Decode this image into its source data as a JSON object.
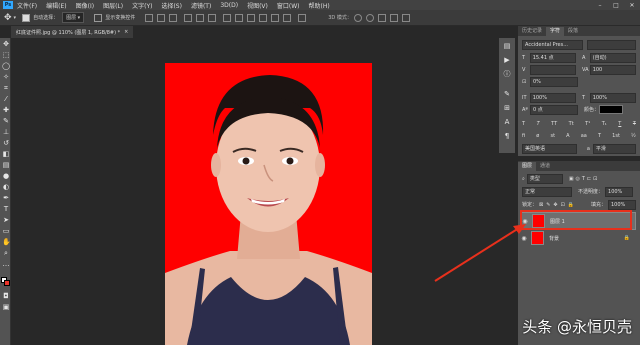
{
  "app": {
    "logo": "Ps"
  },
  "menu": [
    "文件(F)",
    "编辑(E)",
    "图像(I)",
    "图层(L)",
    "文字(Y)",
    "选择(S)",
    "滤镜(T)",
    "3D(D)",
    "视图(V)",
    "窗口(W)",
    "帮助(H)"
  ],
  "window_controls": {
    "minimize": "–",
    "maximize": "□",
    "close": "✕"
  },
  "options_bar": {
    "auto_select_label": "自动选择：",
    "auto_select_value": "图层",
    "transform_label": "显示变换控件"
  },
  "document_tab": {
    "title": "红底证件照.jpg @ 110% (图层 1, RGB/8#) *",
    "close": "×"
  },
  "character_panel": {
    "tabs": [
      "历史记录",
      "字符",
      "段落"
    ],
    "active_tab": 1,
    "font_family": "Accidental Pres...",
    "font_size": "15.41 点",
    "leading": "(自动)",
    "kerning": "0%",
    "tracking": "100",
    "scale_v": "100%",
    "scale_h": "100%",
    "baseline": "0 点",
    "color_label": "颜色：",
    "language": "美国英语",
    "aa_label": "a",
    "aa_value": "平滑"
  },
  "layers_panel": {
    "tabs": [
      "图层",
      "通道"
    ],
    "active_tab": 0,
    "kind_filter": "类型",
    "blend_mode": "正常",
    "opacity_label": "不透明度：",
    "opacity_value": "100%",
    "lock_label": "锁定：",
    "fill_label": "填充：",
    "fill_value": "100%",
    "layers": [
      {
        "name": "图层 1",
        "selected": true
      },
      {
        "name": "背景",
        "selected": false,
        "locked": true
      }
    ]
  },
  "annotation": {
    "color": "#e8301c"
  },
  "watermark": "头条 @永恒贝壳"
}
